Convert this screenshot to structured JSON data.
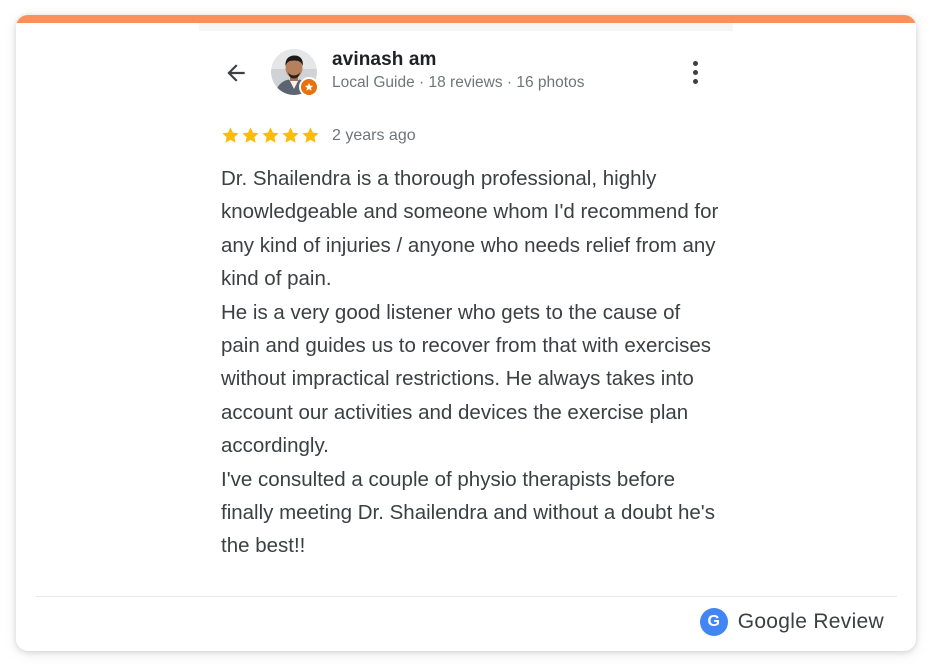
{
  "colors": {
    "accent_bar": "#ff8f59",
    "star": "#fbbc04",
    "badge": "#e8710a",
    "google_blue": "#4285f4",
    "text_primary": "#202124",
    "text_secondary": "#70757a",
    "text_body": "#3c4043"
  },
  "header": {
    "back_icon": "arrow-back-icon",
    "reviewer_name": "avinash am",
    "reviewer_meta": "Local Guide · 18 reviews · 16 photos",
    "more_icon": "more-vert-icon"
  },
  "review": {
    "rating": 5,
    "max_rating": 5,
    "time": "2 years ago",
    "paragraphs": [
      "Dr. Shailendra is a thorough professional, highly knowledgeable and someone whom I'd recommend for any kind of injuries / anyone who needs relief from any kind of pain.",
      "He is a very good listener who gets to the cause of pain and guides us to recover from that with exercises without impractical restrictions. He always takes into account our activities and devices the exercise plan accordingly.",
      "I've consulted a couple of physio therapists before finally meeting Dr. Shailendra and without a doubt he's the best!!"
    ]
  },
  "footer": {
    "badge_letter": "G",
    "label": "Google Review"
  }
}
